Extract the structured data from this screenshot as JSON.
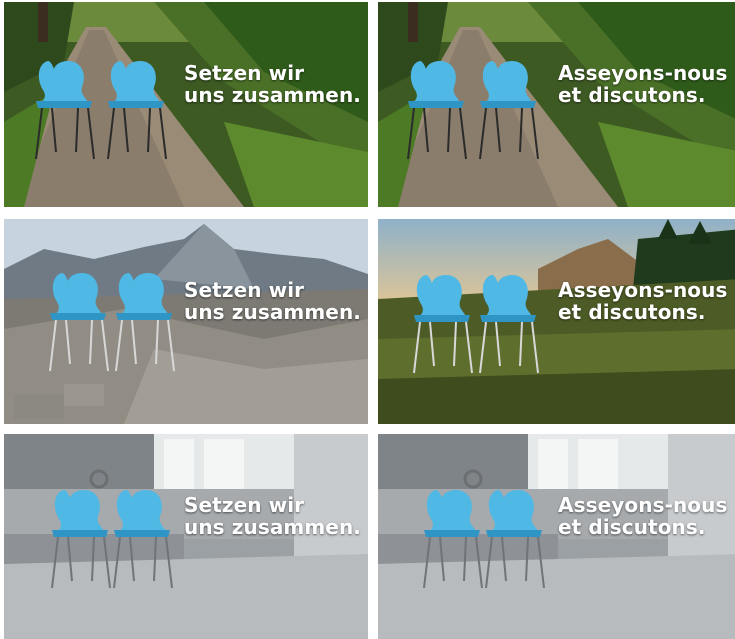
{
  "colors": {
    "chair": "#4fb8e4",
    "chair_shadow": "#2f95c4",
    "caption_text": "#ffffff"
  },
  "tiles": [
    {
      "scene": "forest-path",
      "language": "de",
      "line1": "Setzen wir",
      "line2": "uns zusammen."
    },
    {
      "scene": "forest-path",
      "language": "fr",
      "line1": "Asseyons-nous",
      "line2": "et discutons."
    },
    {
      "scene": "rocky-mountains",
      "language": "de",
      "line1": "Setzen wir",
      "line2": "uns zusammen."
    },
    {
      "scene": "mountain-meadow-sunset",
      "language": "fr",
      "line1": "Asseyons-nous",
      "line2": "et discutons."
    },
    {
      "scene": "empty-concrete-room",
      "language": "de",
      "line1": "Setzen wir",
      "line2": "uns zusammen."
    },
    {
      "scene": "empty-concrete-room",
      "language": "fr",
      "line1": "Asseyons-nous",
      "line2": "et discutons."
    }
  ]
}
